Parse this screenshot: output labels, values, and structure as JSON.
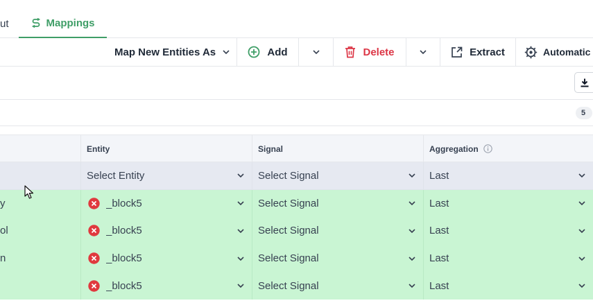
{
  "tabs": {
    "partial_label": "ut",
    "active_label": "Mappings"
  },
  "toolbar": {
    "map_label": "Map New Entities As",
    "add_label": "Add",
    "delete_label": "Delete",
    "extract_label": "Extract",
    "automatic_label": "Automatic"
  },
  "counts": {
    "badge": "5"
  },
  "table": {
    "headers": [
      "",
      "Entity",
      "Signal",
      "Aggregation"
    ],
    "filter_row": {
      "entity_placeholder": "Select Entity",
      "signal_placeholder": "Select Signal",
      "aggregation_value": "Last"
    },
    "rows": [
      {
        "name_fragment": "y",
        "entity": "_block5",
        "signal": "Select Signal",
        "aggregation": "Last"
      },
      {
        "name_fragment": "ol",
        "entity": "_block5",
        "signal": "Select Signal",
        "aggregation": "Last"
      },
      {
        "name_fragment": "n",
        "entity": "_block5",
        "signal": "Select Signal",
        "aggregation": "Last"
      },
      {
        "name_fragment": "",
        "entity": "_block5",
        "signal": "Select Signal",
        "aggregation": "Last"
      }
    ]
  },
  "colors": {
    "accent_green": "#3f9e67",
    "delete_red": "#dc3545",
    "mapped_row_bg": "#c9f5d3",
    "error_icon": "#e0393e"
  }
}
